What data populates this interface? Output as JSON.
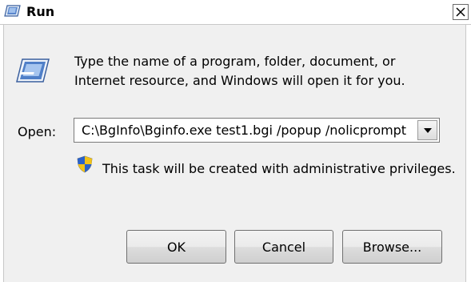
{
  "window": {
    "title": "Run",
    "close_icon": "close-icon"
  },
  "description": {
    "line1": "Type the name of a program, folder, document, or",
    "line2": "Internet resource, and Windows will open it for you."
  },
  "open": {
    "label": "Open:",
    "value": "C:\\BgInfo\\Bginfo.exe test1.bgi /popup /nolicprompt"
  },
  "admin_notice": {
    "text": "This task will be created with administrative privileges.",
    "icon": "uac-shield-icon"
  },
  "buttons": {
    "ok": "OK",
    "cancel": "Cancel",
    "browse": "Browse..."
  },
  "colors": {
    "face": "#f0f0f0",
    "border": "#707070",
    "shield_blue": "#2a62c9",
    "shield_yellow": "#f2c318"
  }
}
